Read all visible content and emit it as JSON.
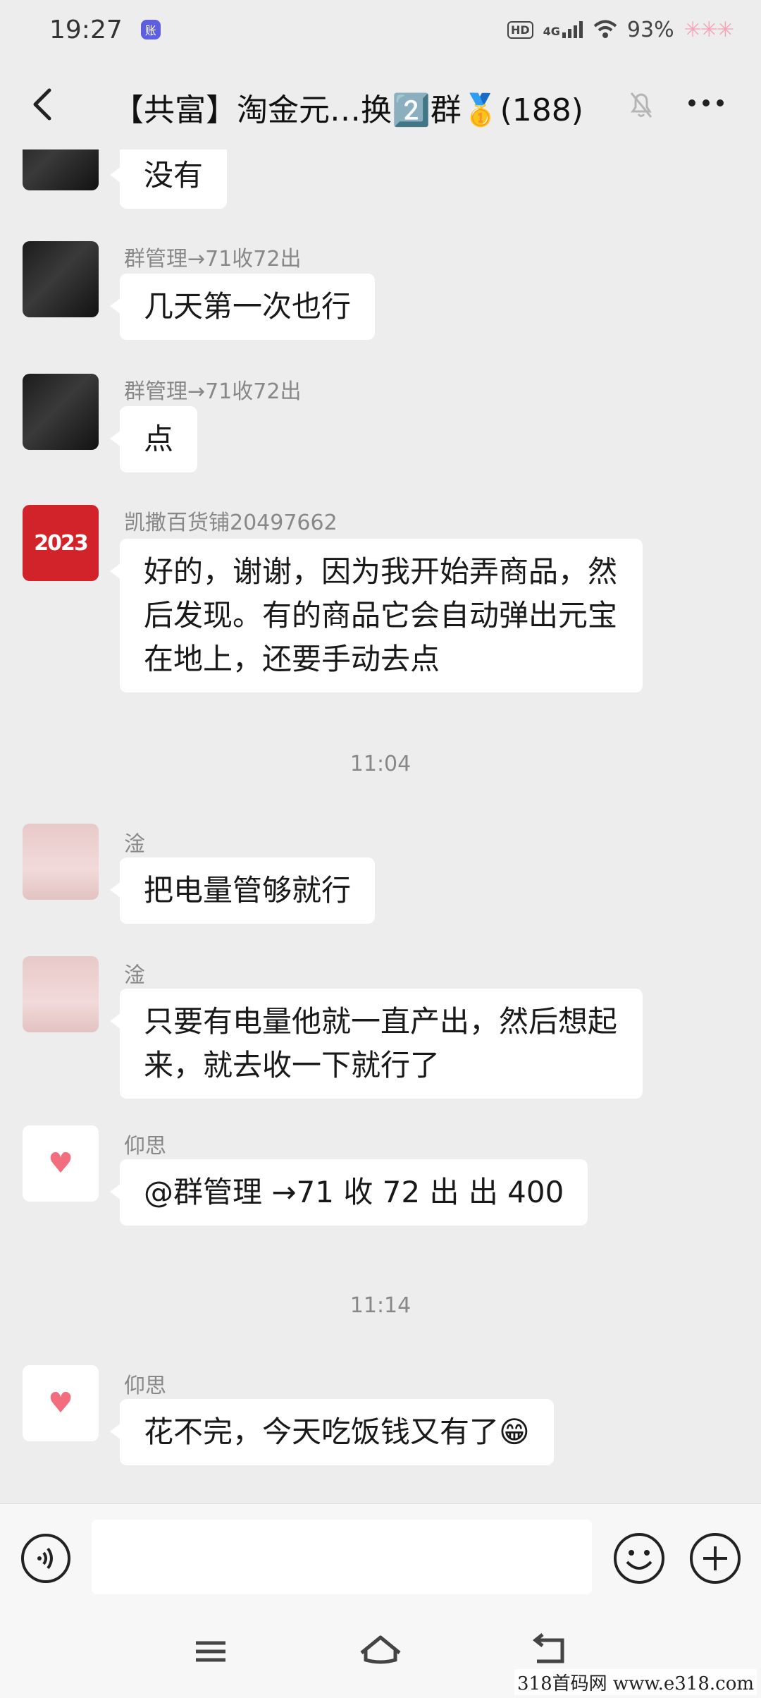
{
  "status_bar": {
    "time": "19:27",
    "app_badge": "账",
    "hd": "HD",
    "network": "4G",
    "battery": "93%",
    "decor": "✳✳✳"
  },
  "header": {
    "title": "【共富】淘金元…换2️⃣群🥇(188)"
  },
  "messages": [
    {
      "sender": "",
      "text": "没有"
    },
    {
      "sender": "群管理→71收72出",
      "text": "几天第一次也行"
    },
    {
      "sender": "群管理→71收72出",
      "text": "点"
    },
    {
      "sender": "凯撒百货铺20497662",
      "text": "好的，谢谢，因为我开始弄商品，然后发现。有的商品它会自动弹出元宝在地上，还要手动去点"
    },
    {
      "sender": "淦",
      "text": "把电量管够就行"
    },
    {
      "sender": "淦",
      "text": "只要有电量他就一直产出，然后想起来，就去收一下就行了"
    },
    {
      "sender": "仰思",
      "text": "@群管理 →71 收 72 出  出 400"
    },
    {
      "sender": "仰思",
      "text": "花不完，今天吃饭钱又有了😁"
    }
  ],
  "time_separators": [
    "11:04",
    "11:14"
  ],
  "avatar_badge": "2023",
  "watermark": "318首码网  www.e318.com"
}
